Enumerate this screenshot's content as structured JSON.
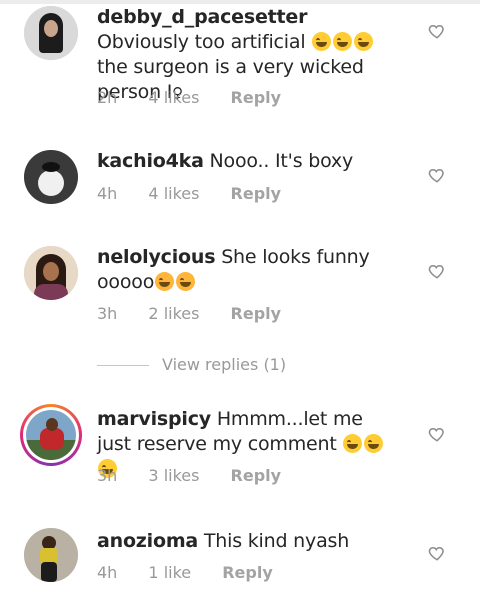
{
  "comments": [
    {
      "user": "debby_d_pacesetter",
      "text_a": "Obviously too artificial",
      "emojis": [
        "grinning-squinting-face",
        "grinning-squinting-face",
        "grinning-squinting-face"
      ],
      "text_b": "the surgeon is a very wicked person I",
      "text_c": "♀",
      "time": "2h",
      "likes": "4 likes",
      "reply": "Reply"
    },
    {
      "user": "kachio4ka",
      "text_a": "Nooo.. It's boxy",
      "time": "4h",
      "likes": "4 likes",
      "reply": "Reply"
    },
    {
      "user": "nelolycious",
      "text_a": "She looks funny ooooo",
      "emojis": [
        "hugging-face",
        "hugging-face"
      ],
      "time": "3h",
      "likes": "2 likes",
      "reply": "Reply"
    },
    {
      "user": "marvispicy",
      "text_a": "Hmmm...let me just reserve my comment",
      "emojis": [
        "grinning-squinting-face",
        "grinning-squinting-face",
        "grinning-squinting-face"
      ],
      "time": "3h",
      "likes": "3 likes",
      "reply": "Reply"
    },
    {
      "user": "anozioma",
      "text_a": "This kind nyash",
      "time": "4h",
      "likes": "1 like",
      "reply": "Reply"
    }
  ],
  "view_replies": "View replies (1)",
  "icons": {
    "like": "heart-outline-icon"
  }
}
